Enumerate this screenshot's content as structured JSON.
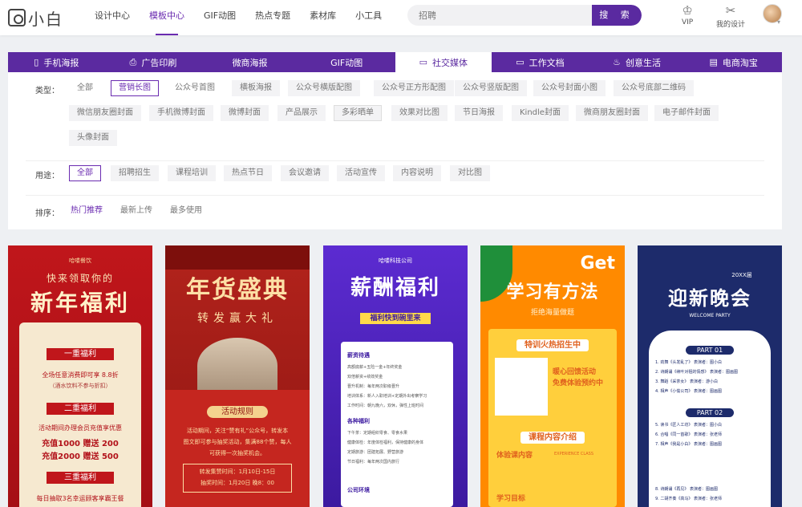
{
  "logo": {
    "text": "小白"
  },
  "nav": [
    "设计中心",
    "模板中心",
    "GIF动图",
    "热点专题",
    "素材库",
    "小工具"
  ],
  "nav_active": "模板中心",
  "search": {
    "value": "招聘",
    "button": "搜 索"
  },
  "tools": [
    {
      "icon": "crown-icon",
      "label": "VIP"
    },
    {
      "icon": "design-tools-icon",
      "label": "我的设计"
    }
  ],
  "categories": [
    {
      "icon": "phone-icon",
      "glyph": "▯",
      "label": "手机海报"
    },
    {
      "icon": "printer-icon",
      "glyph": "⎙",
      "label": "广告印刷"
    },
    {
      "icon": "",
      "glyph": "",
      "label": "微商海报"
    },
    {
      "icon": "",
      "glyph": "",
      "label": "GIF动图"
    },
    {
      "icon": "chat-icon",
      "glyph": "▭",
      "label": "社交媒体"
    },
    {
      "icon": "monitor-icon",
      "glyph": "▭",
      "label": "工作文档"
    },
    {
      "icon": "cup-icon",
      "glyph": "♨",
      "label": "创意生活"
    },
    {
      "icon": "shop-icon",
      "glyph": "▤",
      "label": "电商淘宝"
    }
  ],
  "category_active": "社交媒体",
  "filters": {
    "type_label": "类型：",
    "type_row1": [
      "全部",
      "营销长图",
      "公众号首图",
      "横板海报",
      "公众号横版配图",
      "公众号正方形配图",
      "公众号竖版配图",
      "公众号封面小图",
      "公众号底部二维码"
    ],
    "type_row2": [
      "微信朋友圈封面",
      "手机微博封面",
      "微博封面",
      "产品展示",
      "多彩晒单",
      "效果对比图",
      "节日海报",
      "Kindle封面",
      "微商朋友圈封面",
      "电子邮件封面"
    ],
    "type_row3": [
      "头像封面"
    ],
    "type_selected": "营销长图",
    "use_label": "用途：",
    "uses": [
      "全部",
      "招聘招生",
      "课程培训",
      "热点节日",
      "会议邀请",
      "活动宣传",
      "内容说明",
      "对比图"
    ],
    "use_selected": "全部",
    "sort_label": "排序：",
    "sorts": [
      "热门推荐",
      "最新上传",
      "最多使用"
    ],
    "sort_selected": "热门推荐"
  },
  "cards": [
    {
      "top": "哈喽餐饮",
      "sub": "快来领取你的",
      "title": "新年福利",
      "lines": [
        "一重福利",
        "全场任意消费即可享 8.8折",
        "（酒水饮料不参与折扣）",
        "二重福利",
        "活动期间办理会员充值享优惠",
        "充值1000 赠送 200",
        "充值2000 赠送 500",
        "三重福利",
        "每日抽取3名幸运顾客享霸王餐"
      ]
    },
    {
      "title": "年货盛典",
      "sub": "转发赢大礼",
      "rule": "活动规则",
      "lines": [
        "活动期间，关注“赞有礼”公众号，转发本",
        "图文即可参与抽奖活动，集满88个赞，每人",
        "可获得一次抽奖机会。",
        "转发集赞时间：1月10日-15日",
        "抽奖时间：1月20日 晚8：00"
      ]
    },
    {
      "top": "哈喽科技公司",
      "title": "薪酬福利",
      "sub": "福利快到碗里来",
      "lines": [
        "薪资待遇",
        "高额底薪+五险一金+年终奖金",
        "双倍薪资+绩效奖金",
        "晋升机制：每年两次职级晋升",
        "培训体系：新人入职培训+定期外出考察学习",
        "工作时间：朝九晚六，双休，弹性上班时间",
        "各种福利",
        "下午茶：定期组织零食、零食水果",
        "健康体检：年度体检福利，保持健康的身体",
        "定期旅游：团建拓展、野营旅游",
        "节日福利：每年两次国内旅行",
        "公司环境"
      ]
    },
    {
      "top": "Get",
      "title": "学习有方法",
      "sub": "拒绝海量做题",
      "badge": "特训火热招生中",
      "lines": [
        "暖心回馈活动",
        "免费体验预约中",
        "课程内容介绍",
        "体验课内容",
        "EXPERIENCE CLASS",
        "学习目标"
      ]
    },
    {
      "top": "20XX届",
      "title": "迎新晚会",
      "sub": "WELCOME PARTY",
      "p1": "PART 01",
      "p2": "PART 02",
      "lines": [
        "1. 劲舞《头发乱了》 表演者：图小白",
        "2. 诗朗诵《续叶对祖的情感》 表演者：图画图",
        "3. 舞蹈《采茶女》 表演者：游小白",
        "4. 相声《小偷公司》 表演者：图画图",
        "5. 读书《匠人工坊》 表演者：图小白",
        "6. 合唱《同一首歌》 表演者：张老师",
        "7. 相声《我是小白》 表演者：图画图",
        "8. 诗朗诵《再见》 表演者：图画图",
        "9. 二胡齐奏《高马》 表演者：张老师"
      ]
    }
  ]
}
